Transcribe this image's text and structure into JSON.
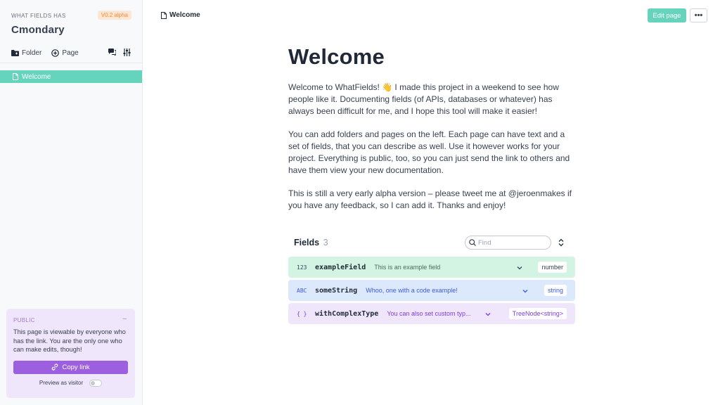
{
  "sidebar": {
    "subtitle": "WHAT FIELDS HAS",
    "title": "Cmondary",
    "version": "V0.2 alpha",
    "toolbar": {
      "folder_label": "Folder",
      "page_label": "Page"
    },
    "tree": [
      {
        "label": "Welcome",
        "active": true
      }
    ],
    "public_card": {
      "label": "PUBLIC",
      "collapse": "–",
      "text": "This page is viewable by everyone who has the link. You are the only one who can make edits, though!",
      "copy_label": "Copy link",
      "preview_label": "Preview as visitor",
      "preview_on": false
    }
  },
  "header": {
    "breadcrumb": "Welcome",
    "edit_label": "Edit page",
    "more_label": "•••"
  },
  "page": {
    "title": "Welcome",
    "paragraphs": [
      "Welcome to WhatFields! 👋 I made this project in a weekend to see how people like it. Documenting fields (of APIs, databases or whatever) has always been difficult for me, and I hope this tool will make it easier!",
      "You can add folders and pages on the left. Each page can have text and a set of fields, that you can describe as well. Use it however works for your project. Everything is public, too, so you can just send the link to others and have them view your new documentation.",
      "This is still a very early alpha version – please tweet me at @jeroenmakes if you have any feedback, so I can add it. Thanks and enjoy!"
    ]
  },
  "fields": {
    "title": "Fields",
    "count": "3",
    "find_placeholder": "Find",
    "rows": [
      {
        "type_icon": "123",
        "name": "exampleField",
        "description": "This is an example field",
        "type": "number",
        "color": "#d4f4e3"
      },
      {
        "type_icon": "ABC",
        "name": "someString",
        "description": "Whoo, one with a code example!",
        "type": "string",
        "color": "#dce8fb"
      },
      {
        "type_icon": "{ }",
        "name": "withComplexType",
        "description": "You can also set custom typ...",
        "type": "TreeNode<string>",
        "color": "#f0e6fb"
      }
    ]
  },
  "colors": {
    "accent": "#66d3bd",
    "purple": "#9c5fe0",
    "version_bg": "#fde7d3",
    "version_text": "#f0883e"
  }
}
